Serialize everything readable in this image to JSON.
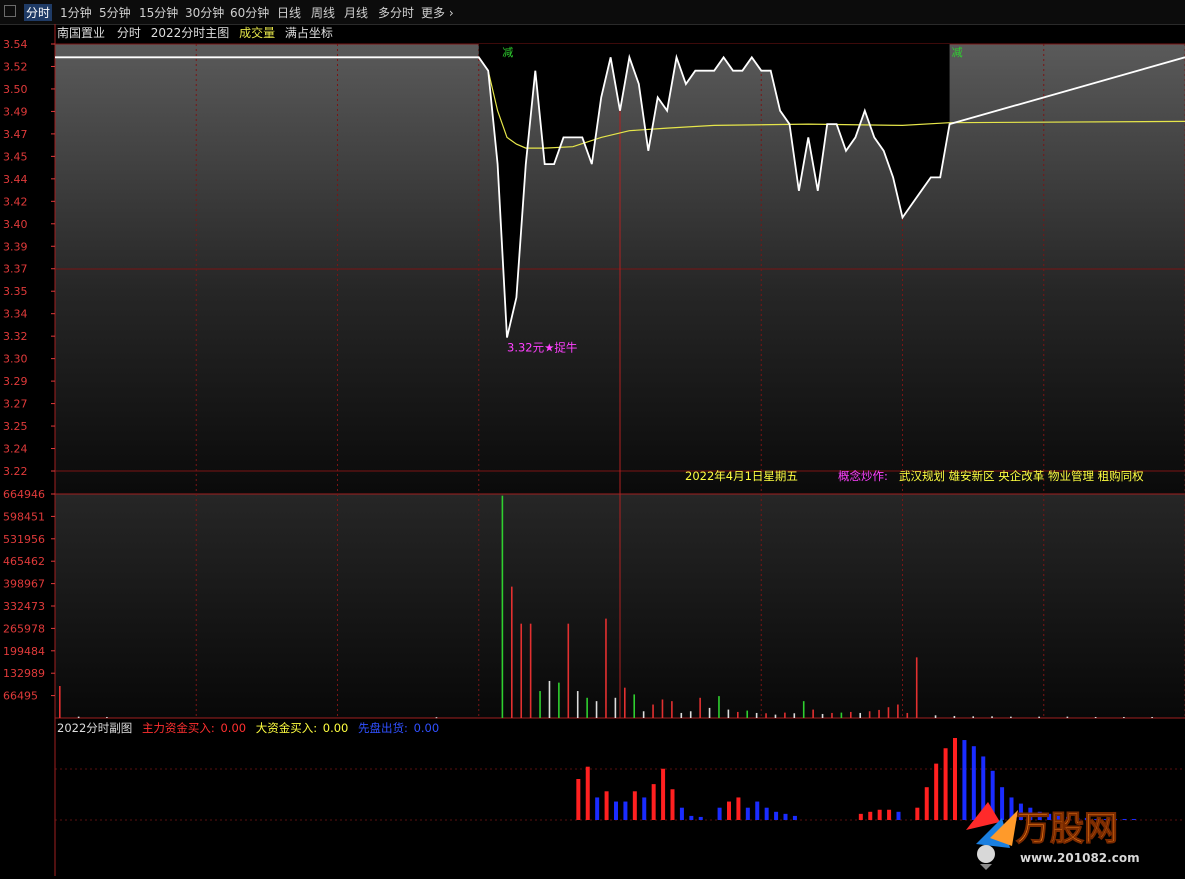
{
  "toolbar": {
    "tabs": [
      {
        "label": "分时",
        "active": true
      },
      {
        "label": "1分钟"
      },
      {
        "label": "5分钟"
      },
      {
        "label": "15分钟"
      },
      {
        "label": "30分钟"
      },
      {
        "label": "60分钟"
      },
      {
        "label": "日线"
      },
      {
        "label": "周线"
      },
      {
        "label": "月线"
      },
      {
        "label": "多分时"
      },
      {
        "label": "更多"
      }
    ]
  },
  "header": {
    "stock": "南国置业",
    "mode": "分时",
    "indicator": "2022分时主图",
    "volume_label": "成交量",
    "coord_label": "满占坐标"
  },
  "annotations": {
    "low_label": "3.32元★捉牛",
    "reduce_mark": "减",
    "date_text": "2022年4月1日星期五",
    "concept_label": "概念炒作:",
    "concepts": "武汉规划 雄安新区 央企改革 物业管理 租购同权"
  },
  "sub_header": {
    "title": "2022分时副图",
    "main_label": "主力资金买入:",
    "main_value": "0.00",
    "big_label": "大资金买入:",
    "big_value": "0.00",
    "out_label": "先盘出货:",
    "out_value": "0.00"
  },
  "logo": {
    "name": "万股网",
    "url": "www.201082.com"
  },
  "colors": {
    "price_line": "#ffffff",
    "avg_line": "#e6e64a",
    "grid": "#7a1414",
    "axis_text": "#e03a3a",
    "vol_up": "#e33030",
    "vol_down": "#2fd02f",
    "vol_flat": "#dddddd",
    "flow_buy": "#ff2020",
    "flow_sell": "#1a2cff",
    "low_mark": "#ff40ff",
    "date_text": "#ffff40",
    "concept_label": "#ff40ff"
  },
  "chart_data": [
    {
      "type": "line",
      "name": "price",
      "ylim": [
        3.22,
        3.54
      ],
      "y_ticks": [
        "3.54",
        "3.52",
        "3.50",
        "3.49",
        "3.47",
        "3.45",
        "3.44",
        "3.42",
        "3.40",
        "3.39",
        "3.37",
        "3.35",
        "3.34",
        "3.32",
        "3.30",
        "3.29",
        "3.27",
        "3.25",
        "3.24",
        "3.22"
      ],
      "x": [
        0,
        45,
        46,
        47,
        48,
        49,
        50,
        51,
        52,
        53,
        54,
        55,
        56,
        57,
        58,
        59,
        60,
        61,
        62,
        63,
        64,
        65,
        66,
        67,
        68,
        69,
        70,
        71,
        72,
        73,
        74,
        75,
        76,
        77,
        78,
        79,
        80,
        81,
        82,
        83,
        84,
        85,
        86,
        87,
        88,
        89,
        90,
        91,
        92,
        93,
        94,
        95,
        120
      ],
      "values": [
        3.53,
        3.53,
        3.52,
        3.45,
        3.32,
        3.35,
        3.45,
        3.52,
        3.45,
        3.45,
        3.47,
        3.47,
        3.47,
        3.45,
        3.5,
        3.53,
        3.49,
        3.53,
        3.51,
        3.46,
        3.5,
        3.49,
        3.53,
        3.51,
        3.52,
        3.52,
        3.52,
        3.53,
        3.52,
        3.52,
        3.53,
        3.52,
        3.52,
        3.49,
        3.48,
        3.43,
        3.47,
        3.43,
        3.48,
        3.48,
        3.46,
        3.47,
        3.49,
        3.47,
        3.46,
        3.44,
        3.41,
        3.42,
        3.43,
        3.44,
        3.44,
        3.48,
        3.53
      ],
      "avg_x": [
        45,
        46,
        47,
        48,
        49,
        50,
        52,
        55,
        58,
        61,
        65,
        70,
        80,
        90,
        95,
        120
      ],
      "avg_values": [
        3.53,
        3.52,
        3.49,
        3.47,
        3.465,
        3.462,
        3.462,
        3.463,
        3.47,
        3.475,
        3.477,
        3.479,
        3.48,
        3.479,
        3.481,
        3.482
      ]
    },
    {
      "type": "bar",
      "name": "volume",
      "ylim": [
        0,
        664946
      ],
      "y_ticks": [
        "664946",
        "598451",
        "531956",
        "465462",
        "398967",
        "332473",
        "265978",
        "199484",
        "132989",
        "66495"
      ],
      "bars": [
        [
          0,
          95000,
          "up"
        ],
        [
          2,
          4000,
          "flat"
        ],
        [
          5,
          3000,
          "flat"
        ],
        [
          40,
          2500,
          "flat"
        ],
        [
          47,
          660000,
          "down"
        ],
        [
          48,
          390000,
          "up"
        ],
        [
          49,
          280000,
          "up"
        ],
        [
          50,
          280000,
          "up"
        ],
        [
          51,
          80000,
          "down"
        ],
        [
          52,
          110000,
          "flat"
        ],
        [
          53,
          105000,
          "down"
        ],
        [
          54,
          280000,
          "up"
        ],
        [
          55,
          80000,
          "flat"
        ],
        [
          56,
          60000,
          "down"
        ],
        [
          57,
          50000,
          "flat"
        ],
        [
          58,
          295000,
          "up"
        ],
        [
          59,
          60000,
          "flat"
        ],
        [
          60,
          90000,
          "up"
        ],
        [
          61,
          70000,
          "down"
        ],
        [
          62,
          20000,
          "flat"
        ],
        [
          63,
          40000,
          "up"
        ],
        [
          64,
          55000,
          "up"
        ],
        [
          65,
          50000,
          "up"
        ],
        [
          66,
          15000,
          "flat"
        ],
        [
          67,
          20000,
          "flat"
        ],
        [
          68,
          60000,
          "up"
        ],
        [
          69,
          30000,
          "flat"
        ],
        [
          70,
          65000,
          "down"
        ],
        [
          71,
          25000,
          "flat"
        ],
        [
          72,
          18000,
          "up"
        ],
        [
          73,
          22000,
          "down"
        ],
        [
          74,
          15000,
          "flat"
        ],
        [
          75,
          14000,
          "up"
        ],
        [
          76,
          10000,
          "flat"
        ],
        [
          77,
          16000,
          "up"
        ],
        [
          78,
          14000,
          "flat"
        ],
        [
          79,
          50000,
          "down"
        ],
        [
          80,
          25000,
          "up"
        ],
        [
          81,
          12000,
          "flat"
        ],
        [
          82,
          15000,
          "up"
        ],
        [
          83,
          16000,
          "down"
        ],
        [
          84,
          18000,
          "up"
        ],
        [
          85,
          15000,
          "flat"
        ],
        [
          86,
          20000,
          "up"
        ],
        [
          87,
          24000,
          "up"
        ],
        [
          88,
          32000,
          "up"
        ],
        [
          89,
          40000,
          "up"
        ],
        [
          90,
          15000,
          "up"
        ],
        [
          91,
          180000,
          "up"
        ],
        [
          93,
          8000,
          "flat"
        ],
        [
          95,
          6000,
          "flat"
        ],
        [
          97,
          5000,
          "flat"
        ],
        [
          99,
          5000,
          "flat"
        ],
        [
          101,
          4000,
          "flat"
        ],
        [
          104,
          4000,
          "flat"
        ],
        [
          107,
          4000,
          "flat"
        ],
        [
          110,
          3000,
          "flat"
        ],
        [
          113,
          3000,
          "flat"
        ],
        [
          116,
          3000,
          "flat"
        ]
      ]
    },
    {
      "type": "bar",
      "name": "fund_flow",
      "ymax": 80,
      "bars": [
        [
          56,
          40,
          "buy"
        ],
        [
          57,
          52,
          "buy"
        ],
        [
          58,
          22,
          "sell"
        ],
        [
          59,
          28,
          "buy"
        ],
        [
          60,
          18,
          "sell"
        ],
        [
          61,
          18,
          "sell"
        ],
        [
          62,
          28,
          "buy"
        ],
        [
          63,
          22,
          "sell"
        ],
        [
          64,
          35,
          "buy"
        ],
        [
          65,
          50,
          "buy"
        ],
        [
          66,
          30,
          "buy"
        ],
        [
          67,
          12,
          "sell"
        ],
        [
          68,
          4,
          "sell"
        ],
        [
          69,
          3,
          "sell"
        ],
        [
          71,
          12,
          "sell"
        ],
        [
          72,
          18,
          "buy"
        ],
        [
          73,
          22,
          "buy"
        ],
        [
          74,
          12,
          "sell"
        ],
        [
          75,
          18,
          "sell"
        ],
        [
          76,
          12,
          "sell"
        ],
        [
          77,
          8,
          "sell"
        ],
        [
          78,
          6,
          "sell"
        ],
        [
          79,
          4,
          "sell"
        ],
        [
          86,
          6,
          "buy"
        ],
        [
          87,
          8,
          "buy"
        ],
        [
          88,
          10,
          "buy"
        ],
        [
          89,
          10,
          "buy"
        ],
        [
          90,
          8,
          "sell"
        ],
        [
          92,
          12,
          "buy"
        ],
        [
          93,
          32,
          "buy"
        ],
        [
          94,
          55,
          "buy"
        ],
        [
          95,
          70,
          "buy"
        ],
        [
          96,
          80,
          "buy"
        ],
        [
          97,
          78,
          "sell"
        ],
        [
          98,
          72,
          "sell"
        ],
        [
          99,
          62,
          "sell"
        ],
        [
          100,
          48,
          "sell"
        ],
        [
          101,
          32,
          "sell"
        ],
        [
          102,
          22,
          "sell"
        ],
        [
          103,
          16,
          "sell"
        ],
        [
          104,
          12,
          "sell"
        ],
        [
          105,
          8,
          "sell"
        ],
        [
          106,
          6,
          "sell"
        ],
        [
          107,
          4,
          "sell"
        ],
        [
          108,
          3,
          "sell"
        ],
        [
          109,
          2,
          "sell"
        ],
        [
          110,
          2,
          "sell"
        ],
        [
          111,
          1,
          "sell"
        ],
        [
          112,
          1,
          "sell"
        ],
        [
          113,
          1,
          "sell"
        ],
        [
          114,
          1,
          "sell"
        ],
        [
          115,
          1,
          "sell"
        ]
      ]
    }
  ]
}
